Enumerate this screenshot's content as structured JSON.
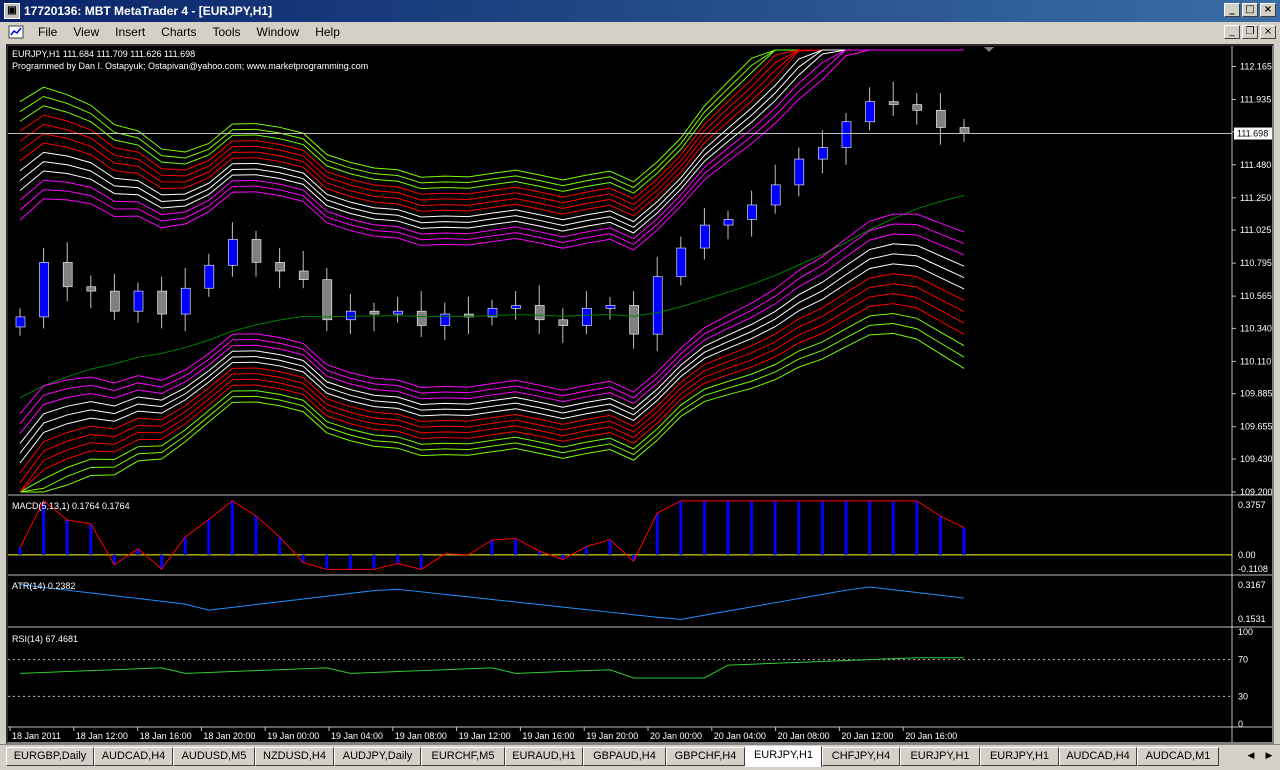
{
  "window": {
    "title": "17720136: MBT MetaTrader 4 - [EURJPY,H1]",
    "app_icon": "metatrader-icon"
  },
  "menu": [
    "File",
    "View",
    "Insert",
    "Charts",
    "Tools",
    "Window",
    "Help"
  ],
  "chart": {
    "symbol_line": "EURJPY,H1  111.684 111.709 111.626 111.698",
    "credit_line": "Programmed by Dan I. Ostapyuk; Ostapivan@yahoo.com; www.marketprogramming.com",
    "current_price_label": "111.698",
    "price_ticks": [
      "112.165",
      "111.935",
      "111.710",
      "111.480",
      "111.250",
      "111.025",
      "110.795",
      "110.565",
      "110.340",
      "110.110",
      "109.885",
      "109.655",
      "109.430",
      "109.200"
    ],
    "time_ticks": [
      "18 Jan 2011",
      "18 Jan 12:00",
      "18 Jan 16:00",
      "18 Jan 20:00",
      "19 Jan 00:00",
      "19 Jan 04:00",
      "19 Jan 08:00",
      "19 Jan 12:00",
      "19 Jan 16:00",
      "19 Jan 20:00",
      "20 Jan 00:00",
      "20 Jan 04:00",
      "20 Jan 08:00",
      "20 Jan 12:00",
      "20 Jan 16:00"
    ],
    "colors": {
      "background": "#000000",
      "bull_candle": "#0000ff",
      "bear_candle": "#808080",
      "wick": "#c0c0c0",
      "band_outer": "#7cfc00",
      "band_mid": "#ff0000",
      "band_inner_white": "#ffffff",
      "band_inner_magenta": "#ff00ff",
      "ma_line": "#008000",
      "macd_hist": "#0000ff",
      "macd_signal": "#ff0000",
      "atr_line": "#1e90ff",
      "rsi_line": "#32cd32"
    }
  },
  "macd": {
    "label": "MACD(5,13,1) 0.1764 0.1764",
    "ticks": [
      "0.3757",
      "0.00",
      "-0.1108"
    ]
  },
  "atr": {
    "label": "ATR(14) 0.2382",
    "ticks": [
      "0.3167",
      "0.1531"
    ]
  },
  "rsi": {
    "label": "RSI(14) 67.4681",
    "ticks": [
      "100",
      "70",
      "30",
      "0"
    ]
  },
  "tabs": [
    "EURGBP,Daily",
    "AUDCAD,H4",
    "AUDUSD,M5",
    "NZDUSD,H4",
    "AUDJPY,Daily",
    "EURCHF,M5",
    "EURAUD,H1",
    "GBPAUD,H4",
    "GBPCHF,H4",
    "EURJPY,H1",
    "CHFJPY,H4",
    "EURJPY,H1",
    "EURJPY,H1",
    "AUDCAD,H4",
    "AUDCAD,M1"
  ],
  "active_tab": 9,
  "chart_data": {
    "type": "candlestick",
    "x": [
      "18 Jan 2011",
      "18 Jan 12:00",
      "18 Jan 16:00",
      "18 Jan 20:00",
      "19 Jan 00:00",
      "19 Jan 04:00",
      "19 Jan 08:00",
      "19 Jan 12:00",
      "19 Jan 16:00",
      "19 Jan 20:00",
      "20 Jan 00:00",
      "20 Jan 04:00",
      "20 Jan 08:00",
      "20 Jan 12:00",
      "20 Jan 16:00"
    ],
    "ohlc_close": [
      110.42,
      110.8,
      110.63,
      110.6,
      110.46,
      110.6,
      110.44,
      110.62,
      110.78,
      110.96,
      110.8,
      110.74,
      110.68,
      110.4,
      110.46,
      110.44,
      110.46,
      110.36,
      110.44,
      110.42,
      110.48,
      110.5,
      110.4,
      110.36,
      110.48,
      110.5,
      110.3,
      110.7,
      110.9,
      111.06,
      111.1,
      111.2,
      111.34,
      111.52,
      111.6,
      111.78,
      111.92,
      111.9,
      111.86,
      111.74,
      111.7
    ],
    "ylim": [
      109.2,
      112.28
    ]
  }
}
